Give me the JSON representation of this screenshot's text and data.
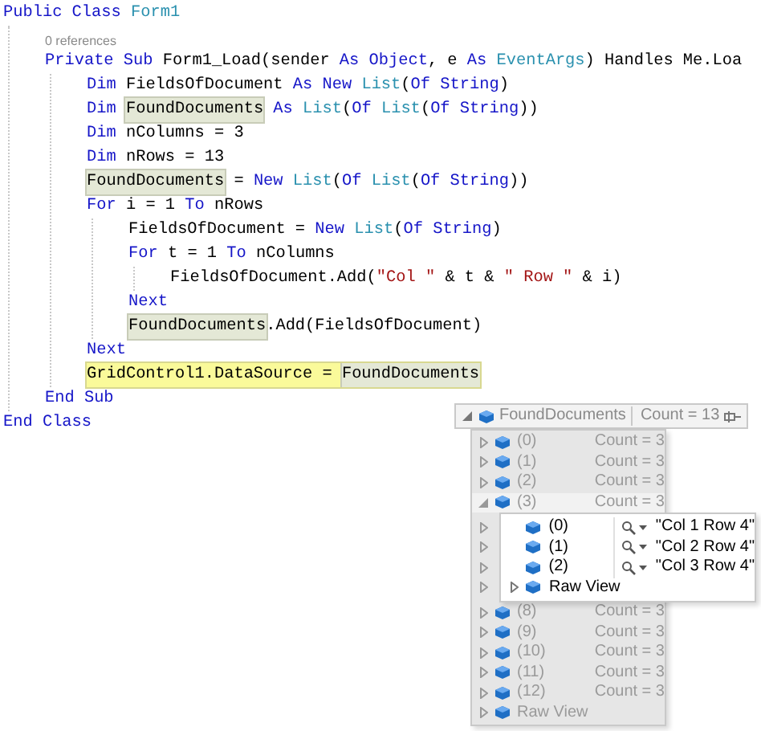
{
  "code": [
    {
      "tokens": [
        {
          "text": "Public Class ",
          "kind": "keyword"
        },
        {
          "text": "Form1",
          "kind": "type"
        }
      ],
      "children": [
        {
          "kind": "codelens",
          "text": "0 references"
        },
        {
          "tokens": [
            {
              "text": "Private Sub ",
              "kind": "keyword"
            },
            {
              "text": "Form1_Load(sender ",
              "kind": "plain"
            },
            {
              "text": "As Object",
              "kind": "keyword"
            },
            {
              "text": ", e ",
              "kind": "plain"
            },
            {
              "text": "As ",
              "kind": "keyword"
            },
            {
              "text": "EventArgs",
              "kind": "type"
            },
            {
              "text": ") Handles Me.Loa",
              "kind": "plain"
            }
          ],
          "children": [
            {
              "tokens": [
                {
                  "text": "Dim ",
                  "kind": "keyword"
                },
                {
                  "text": "FieldsOfDocument ",
                  "kind": "plain"
                },
                {
                  "text": "As New ",
                  "kind": "keyword"
                },
                {
                  "text": "List",
                  "kind": "type"
                },
                {
                  "text": "(",
                  "kind": "plain"
                },
                {
                  "text": "Of String",
                  "kind": "keyword"
                },
                {
                  "text": ")",
                  "kind": "plain"
                }
              ]
            },
            {
              "tokens": [
                {
                  "text": "Dim ",
                  "kind": "keyword"
                },
                {
                  "text": "FoundDocuments",
                  "kind": "reference"
                },
                {
                  "text": " As ",
                  "kind": "keyword"
                },
                {
                  "text": "List",
                  "kind": "type"
                },
                {
                  "text": "(",
                  "kind": "plain"
                },
                {
                  "text": "Of ",
                  "kind": "keyword"
                },
                {
                  "text": "List",
                  "kind": "type"
                },
                {
                  "text": "(",
                  "kind": "plain"
                },
                {
                  "text": "Of String",
                  "kind": "keyword"
                },
                {
                  "text": "))",
                  "kind": "plain"
                }
              ]
            },
            {
              "tokens": [
                {
                  "text": "Dim ",
                  "kind": "keyword"
                },
                {
                  "text": "nColumns = 3",
                  "kind": "plain"
                }
              ]
            },
            {
              "tokens": [
                {
                  "text": "Dim ",
                  "kind": "keyword"
                },
                {
                  "text": "nRows = 13",
                  "kind": "plain"
                }
              ]
            },
            {
              "tokens": [
                {
                  "text": "FoundDocuments",
                  "kind": "reference"
                },
                {
                  "text": " = ",
                  "kind": "plain"
                },
                {
                  "text": "New ",
                  "kind": "keyword"
                },
                {
                  "text": "List",
                  "kind": "type"
                },
                {
                  "text": "(",
                  "kind": "plain"
                },
                {
                  "text": "Of ",
                  "kind": "keyword"
                },
                {
                  "text": "List",
                  "kind": "type"
                },
                {
                  "text": "(",
                  "kind": "plain"
                },
                {
                  "text": "Of String",
                  "kind": "keyword"
                },
                {
                  "text": "))",
                  "kind": "plain"
                }
              ]
            },
            {
              "tokens": [
                {
                  "text": "For ",
                  "kind": "keyword"
                },
                {
                  "text": "i = 1 ",
                  "kind": "plain"
                },
                {
                  "text": "To ",
                  "kind": "keyword"
                },
                {
                  "text": "nRows",
                  "kind": "plain"
                }
              ],
              "children": [
                {
                  "tokens": [
                    {
                      "text": "FieldsOfDocument = ",
                      "kind": "plain"
                    },
                    {
                      "text": "New ",
                      "kind": "keyword"
                    },
                    {
                      "text": "List",
                      "kind": "type"
                    },
                    {
                      "text": "(",
                      "kind": "plain"
                    },
                    {
                      "text": "Of String",
                      "kind": "keyword"
                    },
                    {
                      "text": ")",
                      "kind": "plain"
                    }
                  ]
                },
                {
                  "tokens": [
                    {
                      "text": "For ",
                      "kind": "keyword"
                    },
                    {
                      "text": "t = 1 ",
                      "kind": "plain"
                    },
                    {
                      "text": "To ",
                      "kind": "keyword"
                    },
                    {
                      "text": "nColumns",
                      "kind": "plain"
                    }
                  ],
                  "children": [
                    {
                      "tokens": [
                        {
                          "text": "FieldsOfDocument.Add(",
                          "kind": "plain"
                        },
                        {
                          "text": "\"Col \"",
                          "kind": "string"
                        },
                        {
                          "text": " & t & ",
                          "kind": "plain"
                        },
                        {
                          "text": "\" Row \"",
                          "kind": "string"
                        },
                        {
                          "text": " & i)",
                          "kind": "plain"
                        }
                      ]
                    }
                  ]
                },
                {
                  "tokens": [
                    {
                      "text": "Next",
                      "kind": "keyword"
                    }
                  ]
                },
                {
                  "tokens": [
                    {
                      "text": "FoundDocuments",
                      "kind": "reference"
                    },
                    {
                      "text": ".Add(FieldsOfDocument)",
                      "kind": "plain"
                    }
                  ]
                }
              ]
            },
            {
              "tokens": [
                {
                  "text": "Next",
                  "kind": "keyword"
                }
              ]
            },
            {
              "current": true,
              "tokens": [
                {
                  "text": "GridControl1.DataSource = ",
                  "kind": "plain"
                },
                {
                  "text": "FoundDocuments",
                  "kind": "reference"
                }
              ]
            }
          ]
        },
        {
          "tokens": [
            {
              "text": "End Sub",
              "kind": "keyword"
            }
          ]
        }
      ]
    },
    {
      "tokens": [
        {
          "text": "End Class",
          "kind": "keyword"
        }
      ]
    }
  ],
  "datatip": {
    "name": "FoundDocuments",
    "value": "Count = 13",
    "expanded": true,
    "items": [
      {
        "name": "(0)",
        "value": "Count = 3",
        "expanded": false
      },
      {
        "name": "(1)",
        "value": "Count = 3",
        "expanded": false
      },
      {
        "name": "(2)",
        "value": "Count = 3",
        "expanded": false
      },
      {
        "name": "(3)",
        "value": "Count = 3",
        "expanded": true,
        "children": [
          {
            "name": "(0)",
            "value": "\"Col 1 Row 4\""
          },
          {
            "name": "(1)",
            "value": "\"Col 2 Row 4\""
          },
          {
            "name": "(2)",
            "value": "\"Col 3 Row 4\""
          },
          {
            "name": "Raw View",
            "expandable": true
          }
        ]
      },
      {
        "name": "(8)",
        "value": "Count = 3",
        "expanded": false
      },
      {
        "name": "(9)",
        "value": "Count = 3",
        "expanded": false
      },
      {
        "name": "(10)",
        "value": "Count = 3",
        "expanded": false
      },
      {
        "name": "(11)",
        "value": "Count = 3",
        "expanded": false
      },
      {
        "name": "(12)",
        "value": "Count = 3",
        "expanded": false
      },
      {
        "name": "Raw View",
        "expanded": false
      }
    ]
  }
}
